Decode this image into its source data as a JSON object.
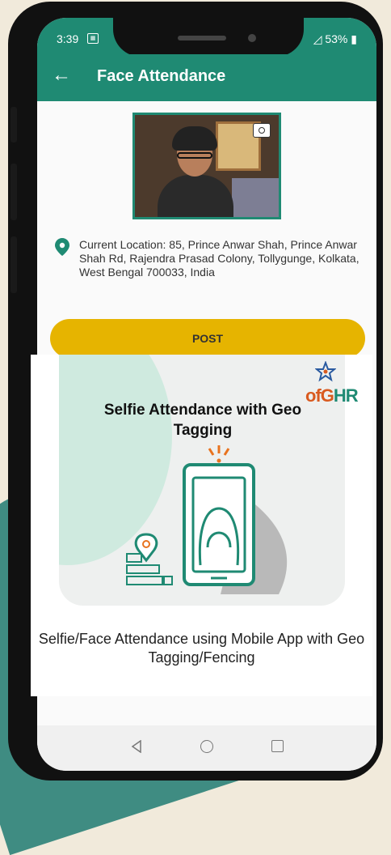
{
  "status_bar": {
    "time": "3:39",
    "battery": "53%"
  },
  "app_bar": {
    "back_icon": "←",
    "title": "Face Attendance"
  },
  "location": {
    "text": "Current Location: 85, Prince Anwar Shah, Prince Anwar Shah Rd, Rajendra Prasad Colony, Tollygunge, Kolkata, West Bengal 700033, India"
  },
  "post_button": {
    "label": "POST"
  },
  "promo": {
    "title": "Selfie Attendance with Geo Tagging",
    "caption": "Selfie/Face Attendance using Mobile App with Geo Tagging/Fencing",
    "brand_prefix": "ofG",
    "brand_suffix": "HR"
  },
  "colors": {
    "accent": "#1f8a73",
    "button": "#e6b400"
  }
}
